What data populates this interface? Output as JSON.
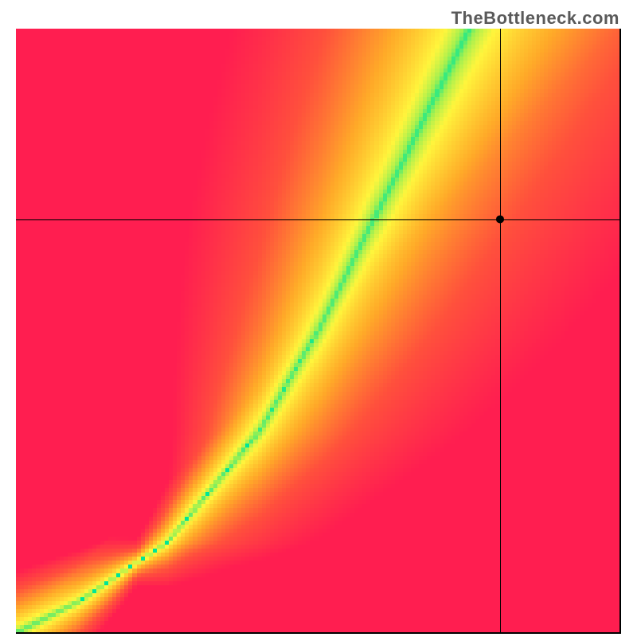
{
  "watermark": "TheBottleneck.com",
  "chart_data": {
    "type": "heatmap",
    "title": "",
    "xlabel": "",
    "ylabel": "",
    "xlim": [
      0,
      1
    ],
    "ylim": [
      0,
      1
    ],
    "grid_resolution": 150,
    "crosshair": {
      "x": 0.8,
      "y": 0.685
    },
    "marker": {
      "x": 0.8,
      "y": 0.685
    },
    "ridge_curve": {
      "description": "locus of optimal (green) balance; cubic-ish curve from origin",
      "control_points": [
        {
          "x": 0.0,
          "y": 0.0
        },
        {
          "x": 0.1,
          "y": 0.05
        },
        {
          "x": 0.25,
          "y": 0.15
        },
        {
          "x": 0.4,
          "y": 0.33
        },
        {
          "x": 0.5,
          "y": 0.5
        },
        {
          "x": 0.6,
          "y": 0.7
        },
        {
          "x": 0.7,
          "y": 0.9
        },
        {
          "x": 0.75,
          "y": 1.0
        }
      ]
    },
    "colormap": {
      "stops": [
        {
          "t": 0.0,
          "r": 0,
          "g": 230,
          "b": 150
        },
        {
          "t": 0.12,
          "r": 160,
          "g": 240,
          "b": 80
        },
        {
          "t": 0.25,
          "r": 255,
          "g": 245,
          "b": 60
        },
        {
          "t": 0.5,
          "r": 255,
          "g": 170,
          "b": 40
        },
        {
          "t": 0.75,
          "r": 255,
          "g": 80,
          "b": 60
        },
        {
          "t": 1.0,
          "r": 255,
          "g": 30,
          "b": 80
        }
      ]
    },
    "ridge_half_width": 0.045,
    "falloff_gamma": 0.55
  }
}
